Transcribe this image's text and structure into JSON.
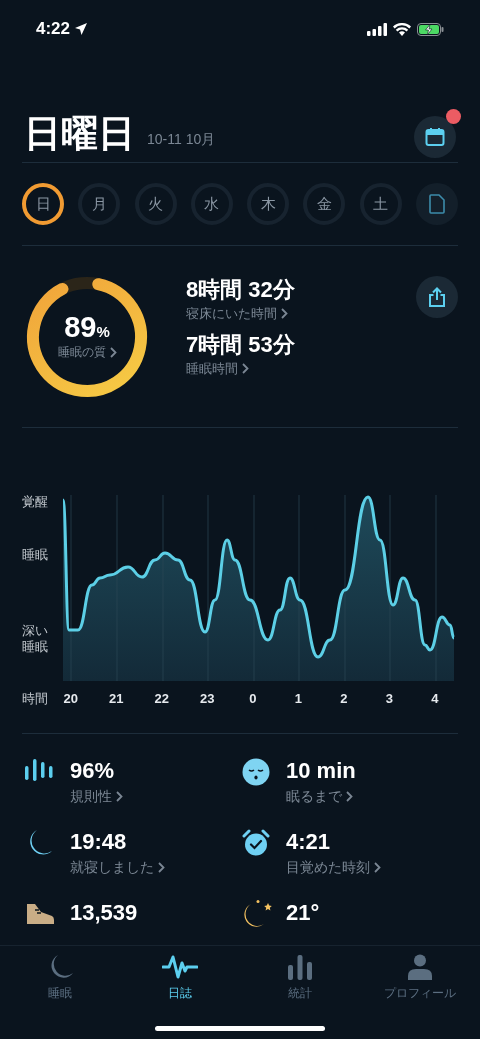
{
  "status_bar": {
    "time": "4:22"
  },
  "header": {
    "title": "日曜日",
    "date": "10-11 10月",
    "calendar_badge": true
  },
  "days": [
    {
      "label": "日",
      "selected": true
    },
    {
      "label": "月",
      "selected": false
    },
    {
      "label": "火",
      "selected": false
    },
    {
      "label": "水",
      "selected": false
    },
    {
      "label": "木",
      "selected": false
    },
    {
      "label": "金",
      "selected": false
    },
    {
      "label": "土",
      "selected": false
    }
  ],
  "summary": {
    "quality": {
      "value": "89",
      "unit": "%",
      "label": "睡眠の質",
      "level": 0.89
    },
    "metrics": [
      {
        "value": "8時間 32分",
        "label": "寝床にいた時間"
      },
      {
        "value": "7時間 53分",
        "label": "睡眠時間"
      }
    ]
  },
  "sleep_graph": {
    "y_labels": [
      "覚醒",
      "睡眠",
      "深い睡眠"
    ],
    "x_title": "時間",
    "x_labels": [
      "20",
      "21",
      "22",
      "23",
      "0",
      "1",
      "2",
      "3",
      "4"
    ]
  },
  "stats": [
    {
      "kind": "regularity",
      "value": "96%",
      "label": "規則性"
    },
    {
      "kind": "latency",
      "value": "10 min",
      "label": "眠るまで"
    },
    {
      "kind": "bedtime",
      "value": "19:48",
      "label": "就寝しました"
    },
    {
      "kind": "wake",
      "value": "4:21",
      "label": "目覚めた時刻"
    },
    {
      "kind": "steps",
      "value": "13,539"
    },
    {
      "kind": "weather",
      "value": "21°"
    }
  ],
  "tab_bar": [
    {
      "kind": "sleep",
      "label": "睡眠",
      "selected": false
    },
    {
      "kind": "journal",
      "label": "日誌",
      "selected": true
    },
    {
      "kind": "stats",
      "label": "統計",
      "selected": false
    },
    {
      "kind": "profile",
      "label": "プロフィール",
      "selected": false
    }
  ]
}
